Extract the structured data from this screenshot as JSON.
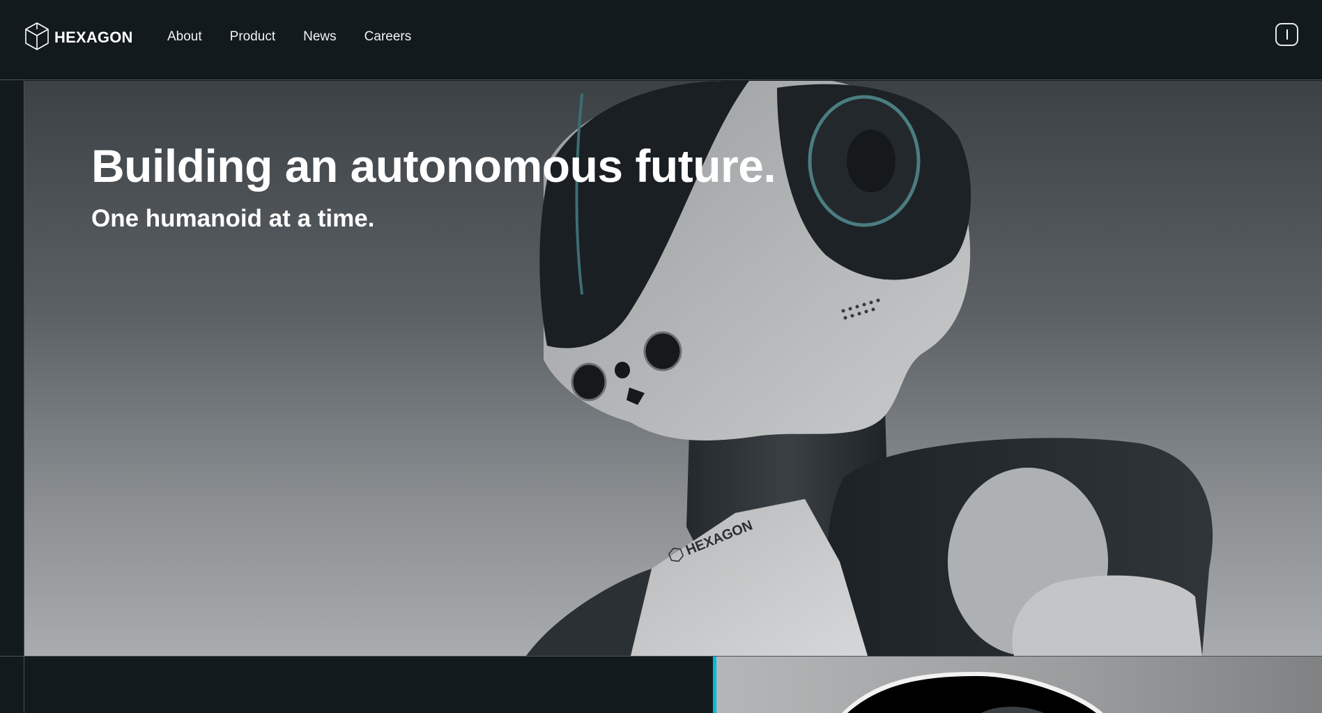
{
  "header": {
    "brand": "HEXAGON",
    "logo_icon": "hexagon-logo-icon",
    "nav": [
      {
        "label": "About"
      },
      {
        "label": "Product"
      },
      {
        "label": "News"
      },
      {
        "label": "Careers"
      }
    ],
    "menu_icon": "menu-toggle-icon"
  },
  "hero": {
    "title": "Building an autonomous future.",
    "subtitle": "One humanoid at a time.",
    "image": "humanoid-robot-photo",
    "robot_chest_brand": "HEXAGON"
  },
  "lower": {
    "accent_color": "#00bcd4",
    "image": "robot-detail-photo"
  },
  "colors": {
    "background": "#121a1e",
    "border": "#4a5257",
    "accent": "#00bcd4"
  }
}
